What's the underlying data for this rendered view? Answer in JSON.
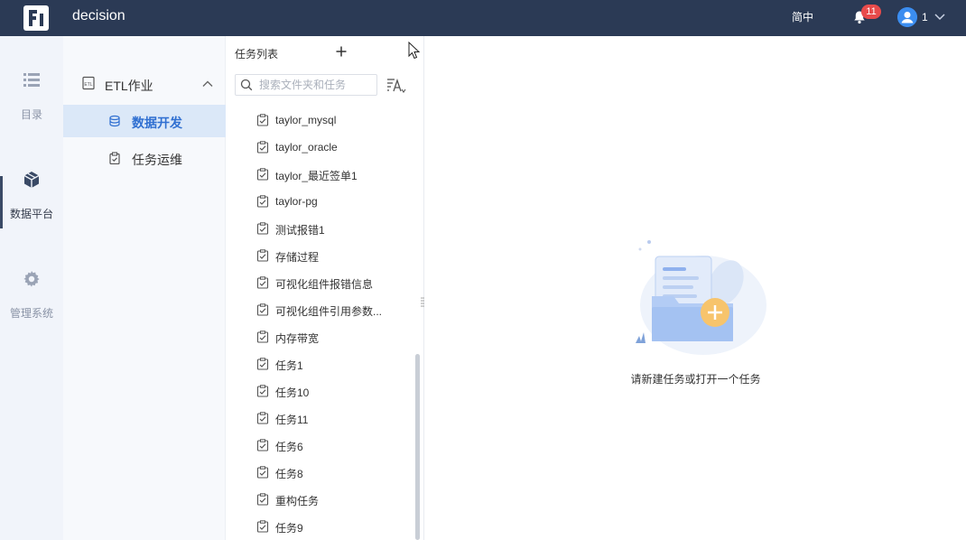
{
  "header": {
    "app_title": "decision",
    "language": "简中",
    "notification_count": "11",
    "user_name": "1"
  },
  "rail": {
    "items": [
      {
        "label": "目录",
        "icon": "list-icon"
      },
      {
        "label": "数据平台",
        "icon": "cube-icon"
      },
      {
        "label": "管理系统",
        "icon": "gear-icon"
      }
    ],
    "active_index": 1
  },
  "nav": {
    "group_label": "ETL作业",
    "items": [
      {
        "label": "数据开发",
        "icon": "database-icon"
      },
      {
        "label": "任务运维",
        "icon": "clipboard-icon"
      }
    ],
    "active_index": 0
  },
  "tasks": {
    "title": "任务列表",
    "search_placeholder": "搜索文件夹和任务",
    "items": [
      "taylor_mysql",
      "taylor_oracle",
      "taylor_最近签单1",
      "taylor-pg",
      "测试报错1",
      "存储过程",
      "可视化组件报错信息",
      "可视化组件引用参数...",
      "内存带宽",
      "任务1",
      "任务10",
      "任务11",
      "任务6",
      "任务8",
      "重构任务",
      "任务9"
    ]
  },
  "main": {
    "empty_message": "请新建任务或打开一个任务"
  },
  "colors": {
    "header_bg": "#2b3a55",
    "accent": "#2f6fd1",
    "badge": "#e84b4b",
    "active_nav_bg": "#dbe8f8"
  }
}
